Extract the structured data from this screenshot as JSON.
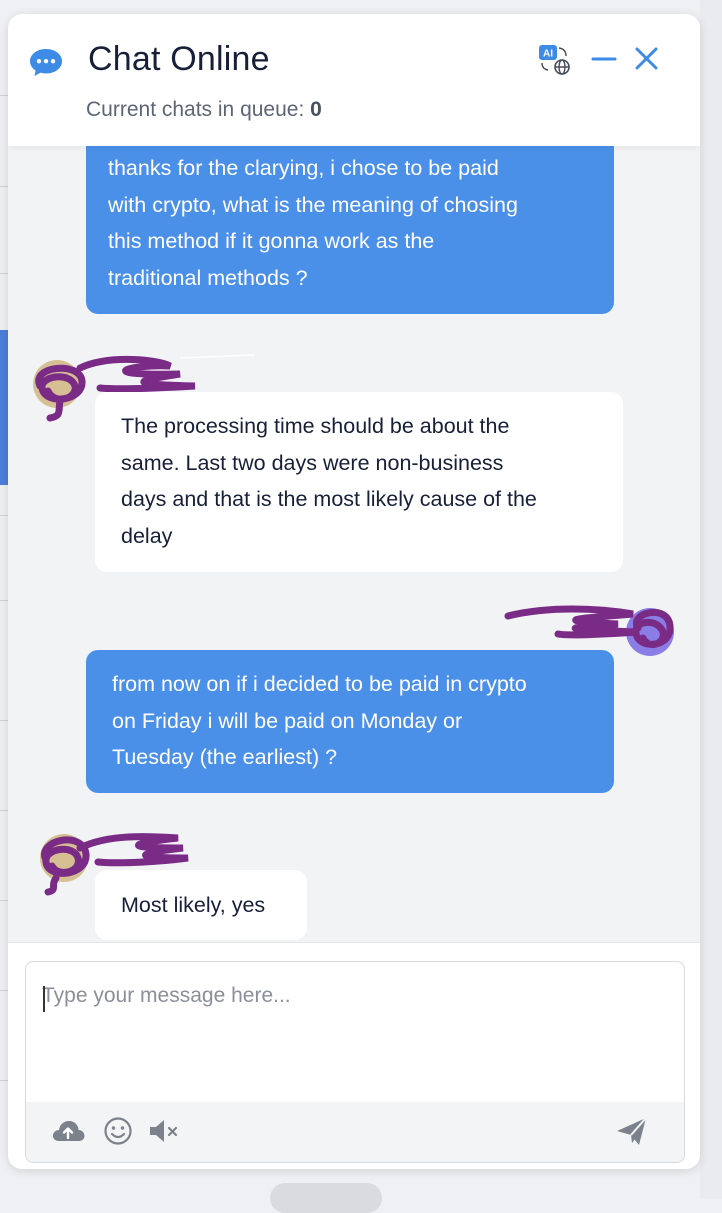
{
  "header": {
    "title": "Chat Online",
    "queue_label": "Current chats in queue: ",
    "queue_count": "0",
    "icons": [
      "chat-bubble-icon",
      "translate-icon",
      "minimize-icon",
      "close-icon"
    ]
  },
  "messages": [
    {
      "from": "user",
      "text": "thanks for the clarying, i chose to be paid\nwith crypto, what is the meaning of chosing\nthis method if it gonna work as the\ntraditional methods ?"
    },
    {
      "from": "agent",
      "text": "The processing time should be about the\nsame. Last two days were non-business\ndays and that is the most likely cause of the\ndelay"
    },
    {
      "from": "user",
      "text": "from now on if i decided to be paid in crypto\non Friday i will be paid on Monday or\nTuesday (the earliest) ?"
    },
    {
      "from": "agent",
      "text": "Most likely, yes"
    }
  ],
  "composer": {
    "placeholder": "Type your message here...",
    "toolbar_icons": [
      "upload-cloud-icon",
      "emoji-icon",
      "mute-icon",
      "send-icon"
    ]
  },
  "colors": {
    "accent": "#4a90e8",
    "title": "#172038",
    "scribble": "#7a2b86"
  }
}
